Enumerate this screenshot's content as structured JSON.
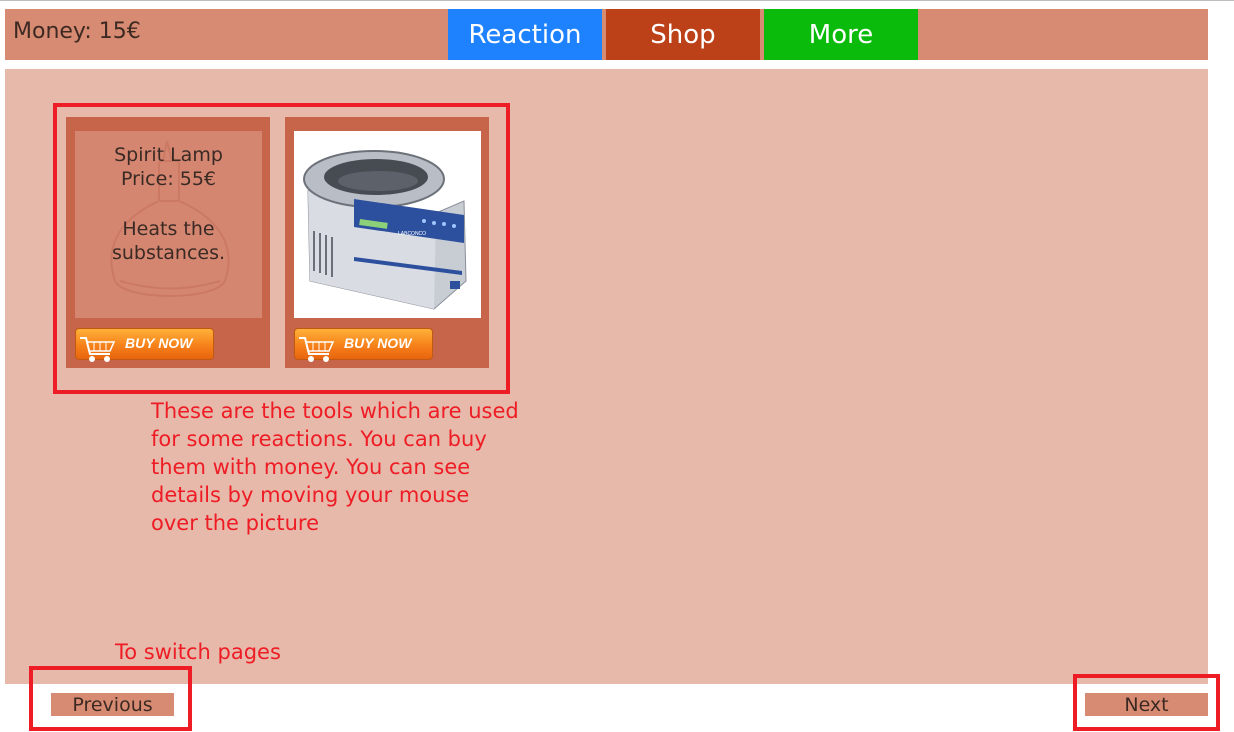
{
  "header": {
    "money": "Money: 15€",
    "tabs": [
      {
        "label": "Reaction",
        "color": "#1e82ff"
      },
      {
        "label": "Shop",
        "color": "#bc4118"
      },
      {
        "label": "More",
        "color": "#0bbb0b"
      }
    ]
  },
  "shop": {
    "items": [
      {
        "name": "Spirit Lamp",
        "price": "Price: 55€",
        "description_line1": "Heats the",
        "description_line2": "substances.",
        "image": "spirit-lamp-image",
        "buy_label": "BUY NOW"
      },
      {
        "image": "centrifuge-image",
        "brand": "LABCONCO",
        "buy_label": "BUY NOW"
      }
    ]
  },
  "annotations": {
    "tools_note": "These are the tools which are used for some reactions. You can buy them with money. You can see details by moving your mouse over the picture",
    "switch_note": "To switch pages",
    "color": "#ee1c24"
  },
  "pagination": {
    "previous": "Previous",
    "next": "Next"
  }
}
